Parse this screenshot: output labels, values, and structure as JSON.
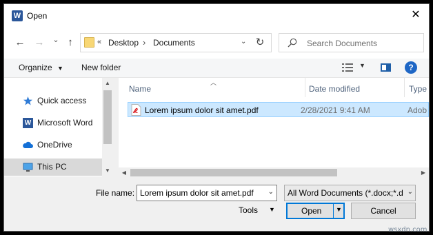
{
  "titlebar": {
    "app_icon": "word-icon",
    "title": "Open",
    "close": "✕"
  },
  "nav": {
    "back": "←",
    "forward": "→",
    "recent": "⌄",
    "up": "↑",
    "breadcrumb_prefix": "«",
    "breadcrumbs": [
      "Desktop",
      "Documents"
    ],
    "search_placeholder": "Search Documents"
  },
  "toolbar": {
    "organize": "Organize",
    "new_folder": "New folder",
    "help": "?"
  },
  "sidebar": {
    "items": [
      {
        "label": "Quick access",
        "icon": "star-icon"
      },
      {
        "label": "Microsoft Word",
        "icon": "word-icon"
      },
      {
        "label": "OneDrive",
        "icon": "cloud-icon"
      },
      {
        "label": "This PC",
        "icon": "monitor-icon",
        "selected": true
      }
    ]
  },
  "filelist": {
    "columns": [
      "Name",
      "Date modified",
      "Type"
    ],
    "rows": [
      {
        "name": "Lorem ipsum dolor sit amet.pdf",
        "date": "2/28/2021 9:41 AM",
        "type": "Adob",
        "selected": true,
        "icon": "pdf-icon"
      }
    ]
  },
  "footer": {
    "file_name_label": "File name:",
    "file_name_value": "Lorem ipsum dolor sit amet.pdf",
    "file_type": "All Word Documents (*.docx;*.d",
    "tools": "Tools",
    "open": "Open",
    "cancel": "Cancel"
  },
  "watermark": "wsxdn.com",
  "colors": {
    "accent": "#0078d7",
    "selection": "#cce8ff",
    "word_blue": "#2b579a"
  }
}
